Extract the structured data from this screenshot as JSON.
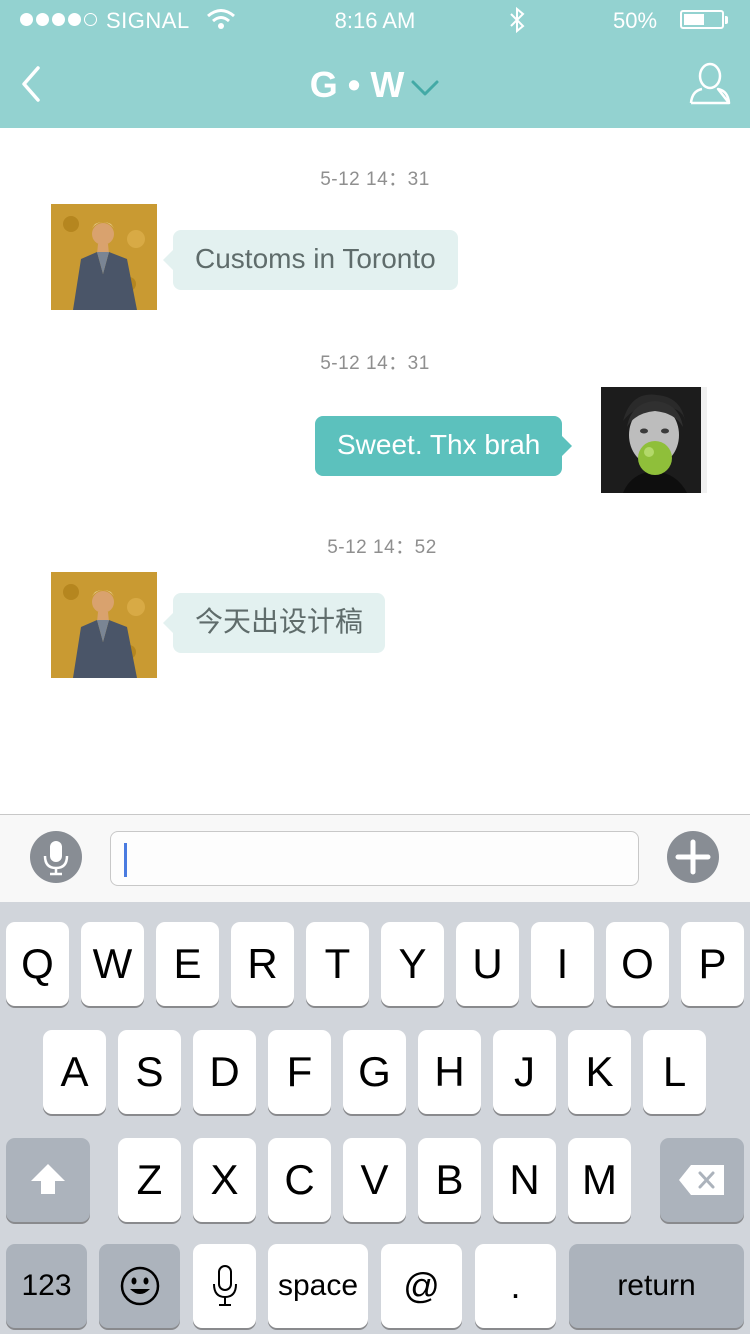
{
  "status_bar": {
    "carrier": "SIGNAL",
    "signal_icon": "signal-dots-icon",
    "time": "8:16 AM",
    "bluetooth_icon": "bluetooth-icon",
    "battery_percent": "50%",
    "battery_level": 0.5
  },
  "nav": {
    "back_icon": "chevron-left-icon",
    "title": "G • W",
    "dropdown_icon": "chevron-down-icon",
    "profile_icon": "person-icon",
    "bg_color": "#93d2d0"
  },
  "messages": [
    {
      "timestamp": "5-12 14：31",
      "direction": "incoming",
      "text": "Customs in Toronto"
    },
    {
      "timestamp": "5-12 14：31",
      "direction": "outgoing",
      "text": "Sweet. Thx brah"
    },
    {
      "timestamp": "5-12 14：52",
      "direction": "incoming",
      "text": "今天出设计稿"
    }
  ],
  "input_bar": {
    "mic_icon": "microphone-icon",
    "value": "",
    "plus_icon": "plus-icon"
  },
  "keyboard": {
    "row1": [
      "Q",
      "W",
      "E",
      "R",
      "T",
      "Y",
      "U",
      "I",
      "O",
      "P"
    ],
    "row2": [
      "A",
      "S",
      "D",
      "F",
      "G",
      "H",
      "J",
      "K",
      "L"
    ],
    "row3": [
      "Z",
      "X",
      "C",
      "V",
      "B",
      "N",
      "M"
    ],
    "shift_icon": "shift-arrow-icon",
    "delete_icon": "backspace-icon",
    "numbers_label": "123",
    "emoji_icon": "smiley-icon",
    "dictation_icon": "microphone-icon",
    "space_label": "space",
    "at_label": "@",
    "period_label": ".",
    "return_label": "return"
  },
  "colors": {
    "accent": "#5cc1bd",
    "incoming_bubble": "#e3f1f0",
    "header": "#93d2d0"
  }
}
